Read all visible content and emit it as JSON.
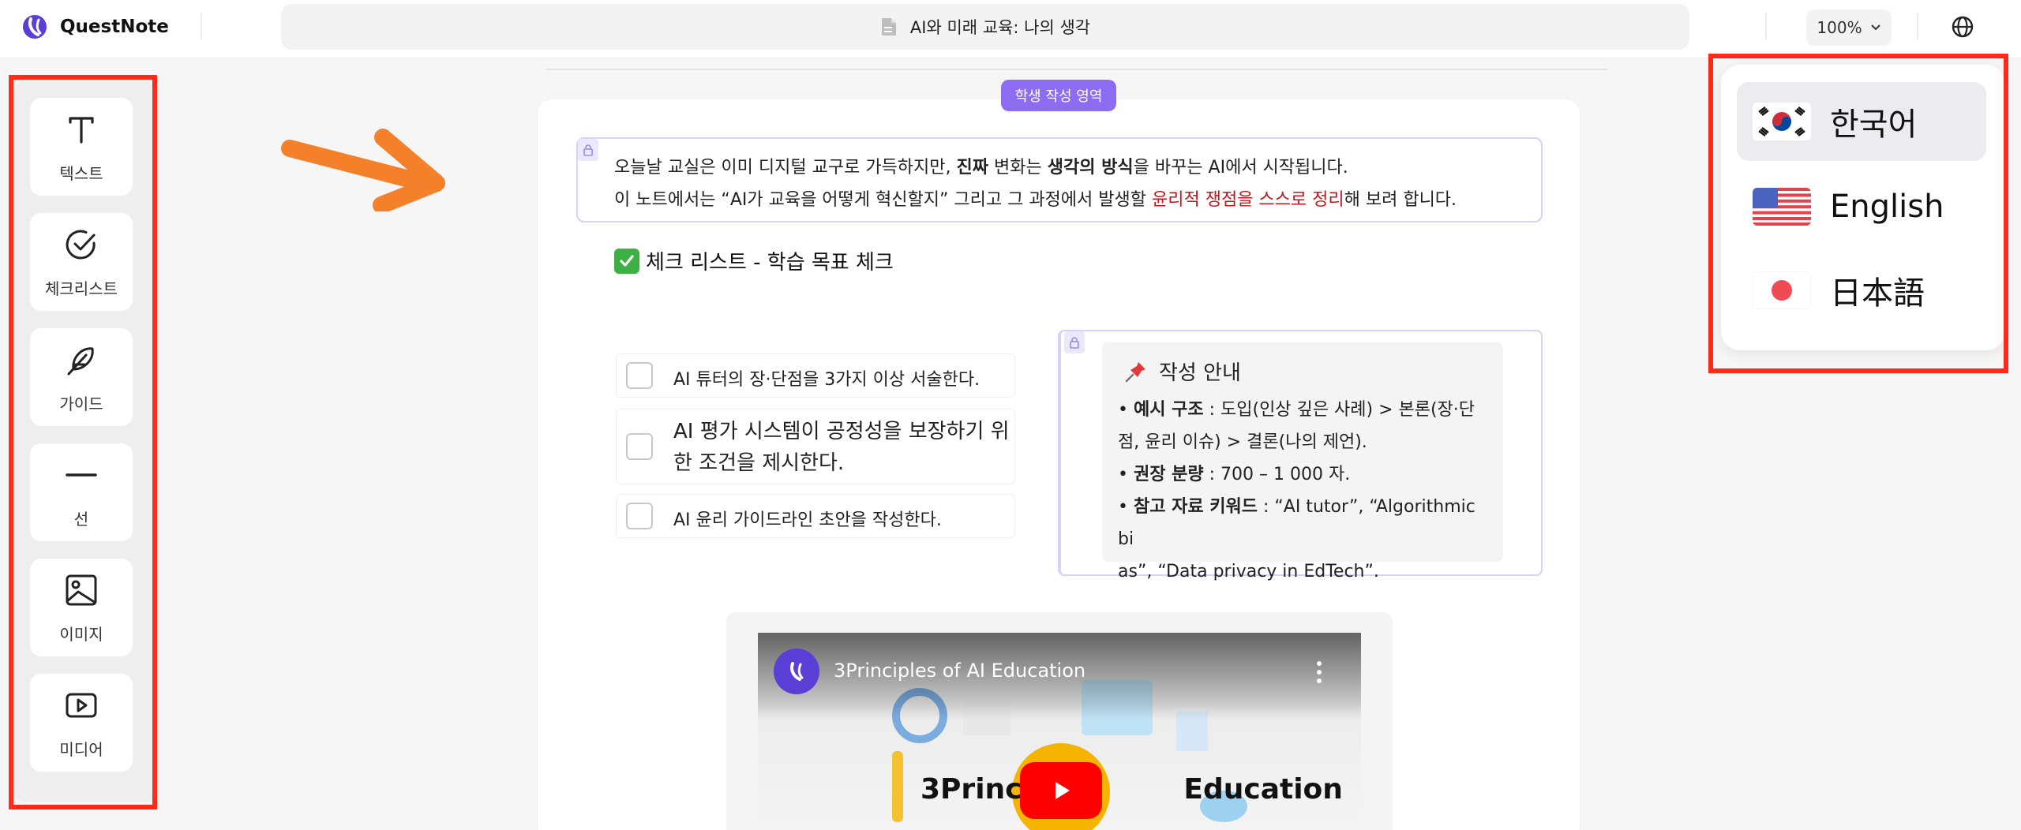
{
  "app": {
    "name": "QuestNote",
    "document_title": "AI와 미래 교육: 나의 생각",
    "zoom_label": "100%",
    "icons": {
      "logo": "questnote-logo-icon",
      "document": "document-icon",
      "zoom_chevron": "chevron-down-icon",
      "language": "globe-icon"
    }
  },
  "toolbar": {
    "items": [
      {
        "label": "텍스트",
        "icon": "text-icon"
      },
      {
        "label": "체크리스트",
        "icon": "check-circle-icon"
      },
      {
        "label": "가이드",
        "icon": "feather-icon"
      },
      {
        "label": "선",
        "icon": "line-icon"
      },
      {
        "label": "이미지",
        "icon": "image-icon"
      },
      {
        "label": "미디어",
        "icon": "play-icon"
      }
    ]
  },
  "document": {
    "area_badge": "학생 작성 영역",
    "intro": {
      "line1": {
        "p1": "오늘날 교실은 이미 디지털 교구로 가득하지만, ",
        "b1": "진짜",
        "p2": " 변화는 ",
        "b2": "생각의 방식",
        "p3": "을 바꾸는 AI에서 시작됩니다."
      },
      "line2": {
        "p1": "이 노트에서는 “AI가 교육을 어떻게 혁신할지” 그리고 그 과정에서 발생할 ",
        "red": "윤리적 쟁점을 스스로 정리",
        "p2": "해 보려 합니다."
      }
    },
    "checklist": {
      "title": "체크 리스트 - 학습 목표 체크",
      "items": [
        {
          "text": "AI 튜터의 장·단점을 3가지 이상 서술한다.",
          "checked": false
        },
        {
          "text_line1": "AI 평가 시스템이 공정성을 보장하기 위",
          "text_line2": "한 조건을 제시한다.",
          "checked": false
        },
        {
          "text": "AI 윤리 가이드라인 초안을 작성한다.",
          "checked": false
        }
      ]
    },
    "guide": {
      "title": "작성 안내",
      "icon": "pushpin-icon",
      "lines": {
        "l1_bold": "예시 구조",
        "l1_rest": " : 도입(인상 깊은 사례) > 본론(장·단",
        "l2": "점, 윤리 이슈) > 결론(나의 제언).",
        "l3_bold": "권장 분량",
        "l3_rest": " : 700 – 1 000 자.",
        "l4_bold": "참고 자료 키워드",
        "l4_rest": " : “AI tutor”, “Algorithmic bi",
        "l5": "as”, “Data privacy in EdTech”."
      }
    },
    "video": {
      "title": "3Principles of AI Education",
      "thumbnail_text_left": "3Principle",
      "thumbnail_text_right": "Education"
    }
  },
  "language_menu": {
    "items": [
      {
        "label": "한국어",
        "flag": "korea-flag-icon",
        "selected": true
      },
      {
        "label": "English",
        "flag": "usa-flag-icon",
        "selected": false
      },
      {
        "label": "日本語",
        "flag": "japan-flag-icon",
        "selected": false
      }
    ]
  },
  "annotations": {
    "highlight_color": "#ff2a1a",
    "arrow_color": "#f5802a",
    "accent_color": "#8c6cf0"
  }
}
